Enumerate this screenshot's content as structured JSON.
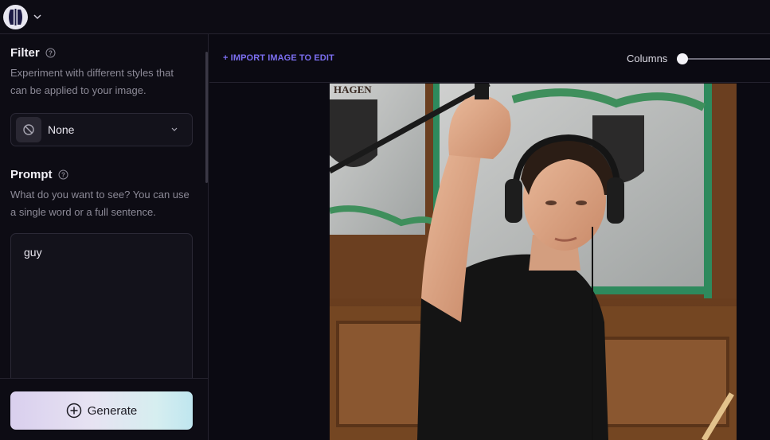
{
  "header": {
    "logo_icon": "brand-logo-icon",
    "menu_icon": "chevron-down-icon"
  },
  "sidebar": {
    "filter": {
      "title": "Filter",
      "description": "Experiment with different styles that can be applied to your image.",
      "selected": "None",
      "icon": "no-filter-icon"
    },
    "prompt": {
      "title": "Prompt",
      "description": "What do you want to see? You can use a single word or a full sentence.",
      "value": "guy"
    },
    "generate_label": "Generate"
  },
  "main": {
    "import_label": "+ IMPORT IMAGE TO EDIT",
    "columns_label": "Columns",
    "columns_value": 0,
    "image": {
      "sign_text": "HAGEN"
    }
  },
  "colors": {
    "accent": "#7b6ef0",
    "background": "#0b0a12",
    "panel": "#0d0c14"
  }
}
